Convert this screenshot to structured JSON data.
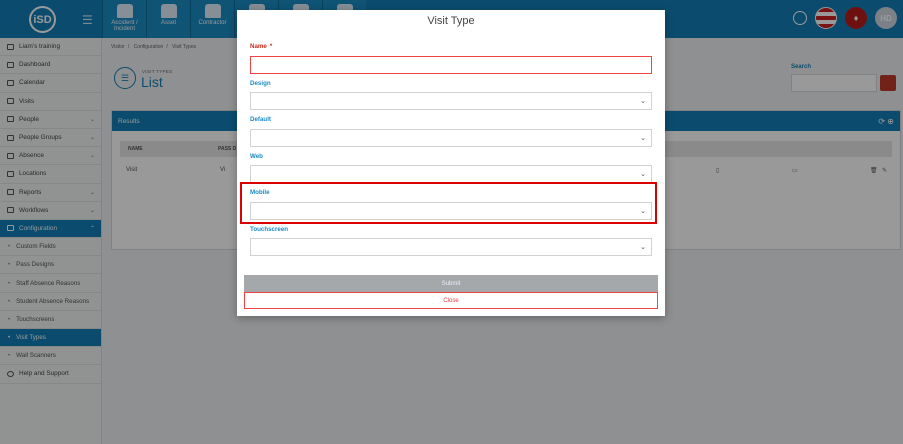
{
  "header": {
    "logo_text": "iSD",
    "tabs": [
      "Accident / Incident",
      "Asset",
      "Contractor"
    ],
    "avatar_initials": "HD"
  },
  "sidebar": {
    "items": [
      {
        "label": "Liam's training",
        "chevron": false
      },
      {
        "label": "Dashboard",
        "chevron": false
      },
      {
        "label": "Calendar",
        "chevron": false
      },
      {
        "label": "Visits",
        "chevron": false
      },
      {
        "label": "People",
        "chevron": true
      },
      {
        "label": "People Groups",
        "chevron": true
      },
      {
        "label": "Absence",
        "chevron": true
      },
      {
        "label": "Locations",
        "chevron": false
      },
      {
        "label": "Reports",
        "chevron": true
      },
      {
        "label": "Workflows",
        "chevron": true
      },
      {
        "label": "Configuration",
        "chevron": true,
        "active": true
      }
    ],
    "subitems": [
      {
        "label": "Custom Fields"
      },
      {
        "label": "Pass Designs"
      },
      {
        "label": "Staff Absence Reasons"
      },
      {
        "label": "Student Absence Reasons"
      },
      {
        "label": "Touchscreens"
      },
      {
        "label": "Visit Types",
        "active": true
      },
      {
        "label": "Wall Scanners"
      }
    ],
    "help_label": "Help and Support"
  },
  "main": {
    "breadcrumb": [
      "Visitor",
      "Configuration",
      "Visit Types"
    ],
    "page_subtitle": "VISIT TYPES",
    "page_title": "List",
    "search_label": "Search",
    "results_label": "Results",
    "table_headers": [
      "NAME",
      "PASS D"
    ],
    "table_rows": [
      {
        "name": "Visit",
        "pass": "Vi"
      }
    ]
  },
  "modal": {
    "title": "Visit Type",
    "name_label": "Name",
    "required_mark": "*",
    "design_label": "Design",
    "default_label": "Default",
    "web_label": "Web",
    "mobile_label": "Mobile",
    "touchscreen_label": "Touchscreen",
    "submit_label": "Submit",
    "close_label": "Close"
  },
  "colors": {
    "primary": "#137fb7",
    "error": "#d0281c"
  }
}
